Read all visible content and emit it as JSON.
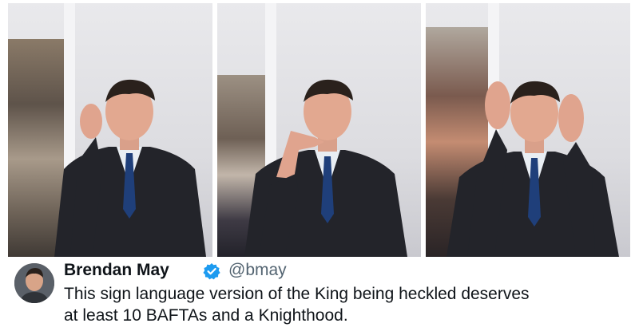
{
  "tweet": {
    "display_name": "Brendan May",
    "handle": "@bmay",
    "text_line1": "This sign language version of the King being heckled deserves",
    "text_line2": "at least 10 BAFTAs and a Knighthood.",
    "verified_icon": "verified-badge-icon",
    "verified_color": "#1d9bf0"
  },
  "photos": {
    "count": 3
  }
}
